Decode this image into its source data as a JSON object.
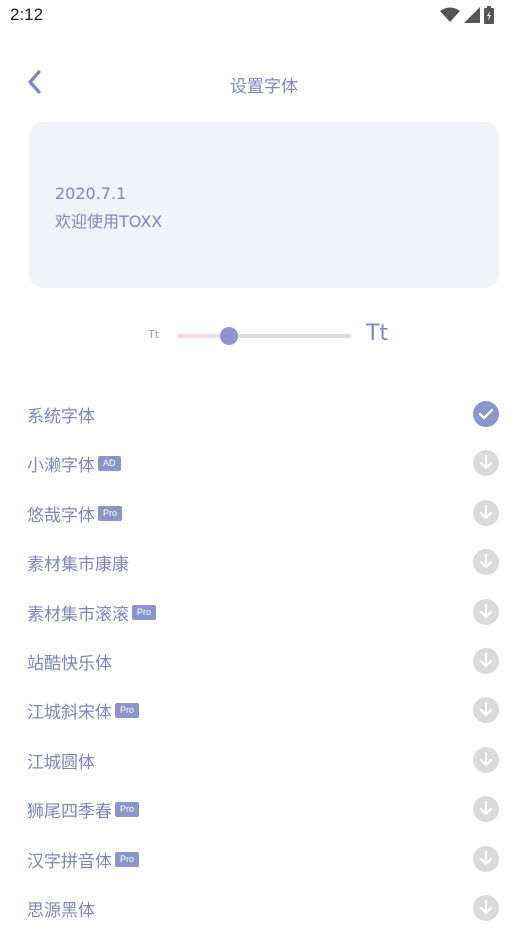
{
  "status_bar": {
    "time": "2:12"
  },
  "header": {
    "title": "设置字体"
  },
  "preview": {
    "date": "2020.7.1",
    "text": "欢迎使用TOXX"
  },
  "size_control": {
    "small_label": "Tt",
    "large_label": "Tt",
    "level": 0.3
  },
  "fonts": [
    {
      "name": "系统字体",
      "badge": "",
      "state": "selected"
    },
    {
      "name": "小濑字体",
      "badge": "AD",
      "state": "download"
    },
    {
      "name": "悠哉字体",
      "badge": "Pro",
      "state": "download"
    },
    {
      "name": "素材集市康康",
      "badge": "",
      "state": "download"
    },
    {
      "name": "素材集市滚滚",
      "badge": "Pro",
      "state": "download"
    },
    {
      "name": "站酷快乐体",
      "badge": "",
      "state": "download"
    },
    {
      "name": "江城斜宋体",
      "badge": "Pro",
      "state": "download"
    },
    {
      "name": "江城圆体",
      "badge": "",
      "state": "download"
    },
    {
      "name": "狮尾四季春",
      "badge": "Pro",
      "state": "download"
    },
    {
      "name": "汉字拼音体",
      "badge": "Pro",
      "state": "download"
    },
    {
      "name": "思源黑体",
      "badge": "",
      "state": "download"
    }
  ],
  "colors": {
    "accent": "#8c95c9",
    "text": "#7d86bd",
    "card": "#f2f3f9",
    "download_bg": "#dadada"
  },
  "icons": {
    "back": "back-arrow-icon",
    "selected": "check-icon",
    "download": "download-icon"
  }
}
